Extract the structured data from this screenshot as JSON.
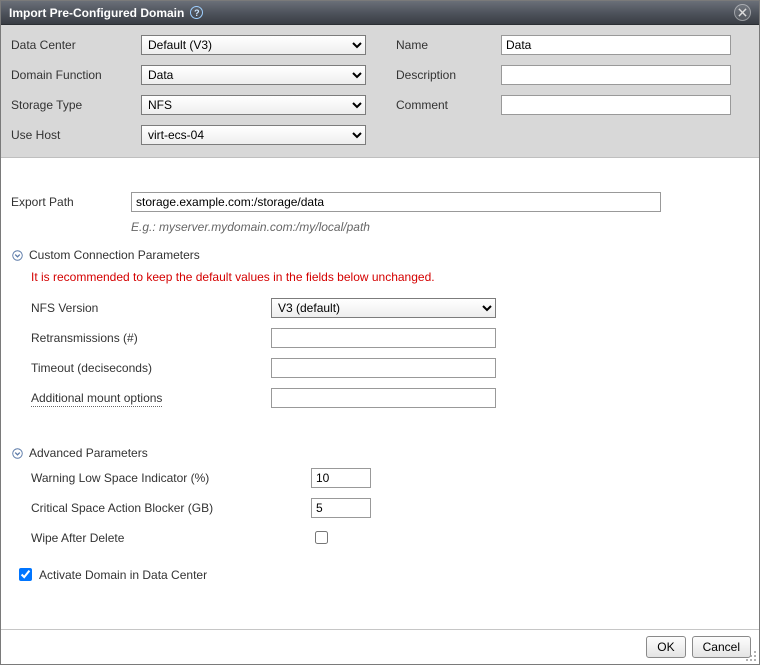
{
  "title": "Import Pre-Configured Domain",
  "top": {
    "data_center_label": "Data Center",
    "data_center_value": "Default (V3)",
    "domain_function_label": "Domain Function",
    "domain_function_value": "Data",
    "storage_type_label": "Storage Type",
    "storage_type_value": "NFS",
    "use_host_label": "Use Host",
    "use_host_value": "virt-ecs-04",
    "name_label": "Name",
    "name_value": "Data",
    "description_label": "Description",
    "description_value": "",
    "comment_label": "Comment",
    "comment_value": ""
  },
  "export": {
    "label": "Export Path",
    "value": "storage.example.com:/storage/data",
    "hint": "E.g.: myserver.mydomain.com:/my/local/path"
  },
  "custom": {
    "title": "Custom Connection Parameters",
    "warning": "It is recommended to keep the default values in the fields below unchanged.",
    "nfs_version_label": "NFS Version",
    "nfs_version_value": "V3 (default)",
    "retransmissions_label": "Retransmissions (#)",
    "retransmissions_value": "",
    "timeout_label": "Timeout (deciseconds)",
    "timeout_value": "",
    "mount_label": "Additional mount options",
    "mount_value": ""
  },
  "advanced": {
    "title": "Advanced Parameters",
    "warn_low_label": "Warning Low Space Indicator (%)",
    "warn_low_value": "10",
    "critical_label": "Critical Space Action Blocker (GB)",
    "critical_value": "5",
    "wipe_label": "Wipe After Delete"
  },
  "activate_label": "Activate Domain in Data Center",
  "buttons": {
    "ok": "OK",
    "cancel": "Cancel"
  }
}
